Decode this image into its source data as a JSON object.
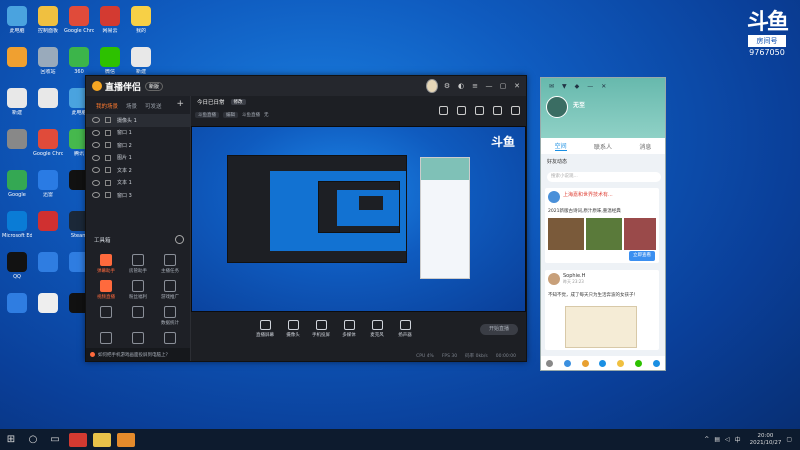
{
  "desktop": {
    "icons": [
      {
        "label": "此电脑",
        "color": "#4aa3df"
      },
      {
        "label": "控制面板",
        "color": "#f0c040"
      },
      {
        "label": "Google Chrome",
        "color": "#e04b3a"
      },
      {
        "label": "网易云",
        "color": "#d33a31"
      },
      {
        "label": "我的",
        "color": "#f7d046"
      },
      {
        "label": "",
        "color": "#f0a030"
      },
      {
        "label": "回收站",
        "color": "#9ab"
      },
      {
        "label": "360",
        "color": "#3cb54a"
      },
      {
        "label": "微信",
        "color": "#2dc100"
      },
      {
        "label": "新建",
        "color": "#e8e8e8"
      },
      {
        "label": "新建",
        "color": "#e8e8e8"
      },
      {
        "label": "",
        "color": "#e8e8e8"
      },
      {
        "label": "此电脑",
        "color": "#4aa3df"
      },
      {
        "label": "360安全",
        "color": "#2f7de1"
      },
      {
        "label": "抖音",
        "color": "#111"
      },
      {
        "label": "",
        "color": "#888"
      },
      {
        "label": "Google Chrome",
        "color": "#e04b3a"
      },
      {
        "label": "腾讯",
        "color": "#46b84d"
      },
      {
        "label": "爱奇艺",
        "color": "#e24336"
      },
      {
        "label": "",
        "color": "#999"
      },
      {
        "label": "Google",
        "color": "#34a853"
      },
      {
        "label": "迅雷",
        "color": "#2a7be4"
      },
      {
        "label": "",
        "color": "#111"
      },
      {
        "label": "",
        "color": "#555"
      },
      {
        "label": "Google Chrome",
        "color": "#e04b3a"
      },
      {
        "label": "Microsoft Edge",
        "color": "#0a7cd6"
      },
      {
        "label": "",
        "color": "#d03030"
      },
      {
        "label": "Steam",
        "color": "#1b2838"
      },
      {
        "label": "",
        "color": "#3a8fdf"
      },
      {
        "label": "",
        "color": "#2dc100"
      },
      {
        "label": "QQ",
        "color": "#121212"
      },
      {
        "label": "",
        "color": "#2f7de1"
      },
      {
        "label": "",
        "color": "#2f7de1"
      },
      {
        "label": "",
        "color": "#f0a030"
      },
      {
        "label": "",
        "color": "#f59f2a"
      },
      {
        "label": "",
        "color": "#2f7de1"
      },
      {
        "label": "",
        "color": "#eee"
      },
      {
        "label": "",
        "color": "#111"
      }
    ]
  },
  "douyu_logo": {
    "mark": "斗鱼",
    "box": "房间号",
    "room_id": "9767050"
  },
  "app": {
    "title": "直播伴侣",
    "version": "新版",
    "left_tabs": [
      "我的场景",
      "场景",
      "可发送"
    ],
    "layers": [
      {
        "label": "摄像头 1"
      },
      {
        "label": "窗口 1"
      },
      {
        "label": "窗口 2"
      },
      {
        "label": "图片 1"
      },
      {
        "label": "文本 2"
      },
      {
        "label": "文本 1"
      },
      {
        "label": "窗口 3"
      }
    ],
    "tools_heading": "工具箱",
    "tools": [
      {
        "label": "弹幕助手",
        "hot": true
      },
      {
        "label": "房管助手",
        "hot": false
      },
      {
        "label": "主播任务",
        "hot": false
      },
      {
        "label": "视频直播",
        "hot": true
      },
      {
        "label": "粉丝福利",
        "hot": false
      },
      {
        "label": "游戏推广",
        "hot": false
      },
      {
        "label": "",
        "hot": false
      },
      {
        "label": "",
        "hot": false
      },
      {
        "label": "数据统计",
        "hot": false
      },
      {
        "label": "",
        "hot": false
      },
      {
        "label": "",
        "hot": false
      },
      {
        "label": "",
        "hot": false
      }
    ],
    "note": "如何把手机游戏画面投屏到电脑上？",
    "room_title": "今日已日常",
    "edit_label": "修改",
    "tags": [
      "斗鱼直播",
      "编辑",
      "斗鱼直播",
      "无"
    ],
    "preview_logo": "斗鱼",
    "controls": [
      "直播屏幕",
      "摄像头",
      "手机投屏",
      "多媒体",
      "麦克风",
      "扬声器"
    ],
    "go_live": "开始直播",
    "status": [
      "CPU 4%",
      "FPS 30",
      "码率 0kb/s",
      "00:00:00"
    ]
  },
  "chat": {
    "user_name": "无至",
    "tabs": [
      "空间",
      "联系人",
      "消息"
    ],
    "sub_header": "好友动态",
    "search_placeholder": "搜索小说观...",
    "posts": [
      {
        "name": "上海嘉和世界技术有...",
        "time": "",
        "text": "2021新版古诗词,原汁原味,重温经典",
        "button": "立即查看"
      },
      {
        "name": "Sophie.H",
        "time": "昨天 23:23",
        "text": "不知不觉，成了每天只为生活奔波的女孩子！",
        "button": ""
      }
    ]
  },
  "taskbar": {
    "search_icon": "search-icon",
    "clock_time": "20:00",
    "clock_date": "2021/10/27"
  }
}
